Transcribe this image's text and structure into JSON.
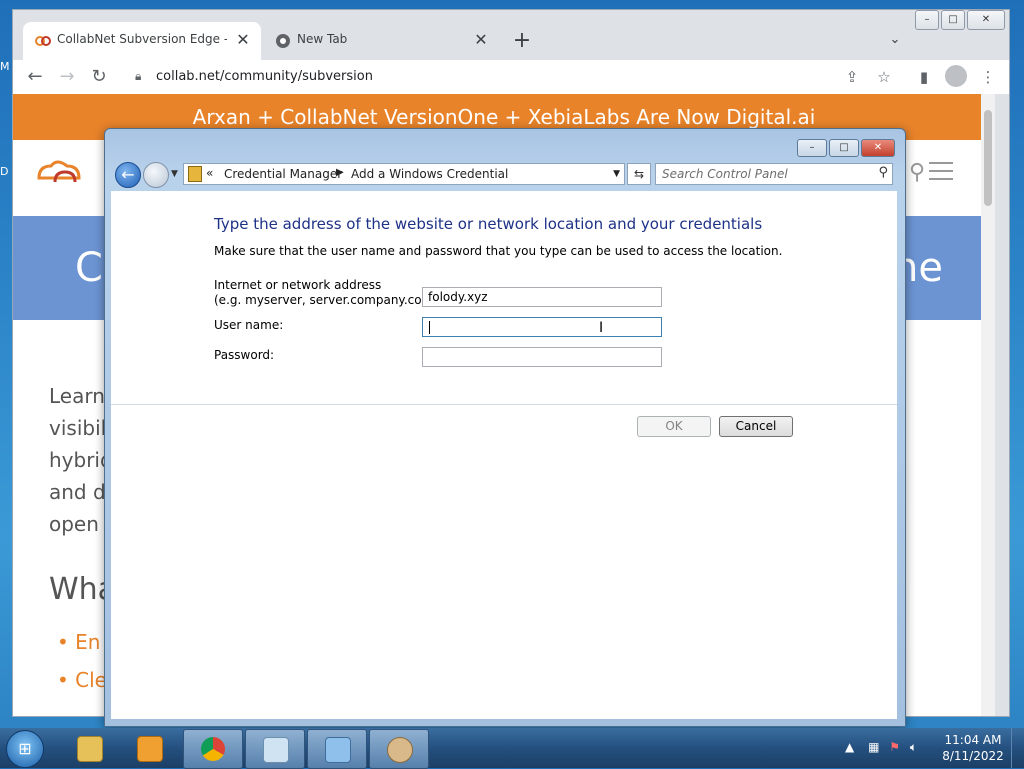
{
  "desktop": {
    "label_m": "M",
    "label_d": "D"
  },
  "browser": {
    "tabs": [
      {
        "title": "CollabNet Subversion Edge - Co",
        "close": "✕"
      },
      {
        "title": "New Tab",
        "close": "✕"
      }
    ],
    "new_tab": "+",
    "tab_search": "⌄",
    "window_buttons": {
      "minimize": "–",
      "maximize": "□",
      "close": "✕"
    },
    "url": "collab.net/community/subversion"
  },
  "webpage": {
    "banner": "Arxan + CollabNet VersionOne + XebiaLabs Are Now Digital.ai",
    "hero_left": "C",
    "hero_right": "ne",
    "body_lines": [
      "Learn",
      "visibili",
      "hybrid",
      "and de",
      "open s"
    ],
    "section_heading": "Wha",
    "bullets": [
      "En",
      "Cle"
    ]
  },
  "dialog": {
    "breadcrumb": {
      "chevrons": "«",
      "segment1": "Credential Manager",
      "separator": "▶",
      "segment2": "Add a Windows Credential"
    },
    "search_placeholder": "Search Control Panel",
    "heading": "Type the address of the website or network location and your credentials",
    "subheading": "Make sure that the user name and password that you type can be used to access the location.",
    "address_label_line1": "Internet or network address",
    "address_label_line2": "(e.g. myserver, server.company.com):",
    "address_value": "folody.xyz",
    "username_label": "User name:",
    "username_value": "",
    "password_label": "Password:",
    "password_value": "",
    "ok_label": "OK",
    "cancel_label": "Cancel"
  },
  "taskbar": {
    "clock_time": "11:04 AM",
    "clock_date": "8/11/2022",
    "tray_arrow": "▲"
  },
  "colors": {
    "banner": "#e8832a",
    "hero": "#6c94d3",
    "dialog_heading": "#1e3287"
  }
}
